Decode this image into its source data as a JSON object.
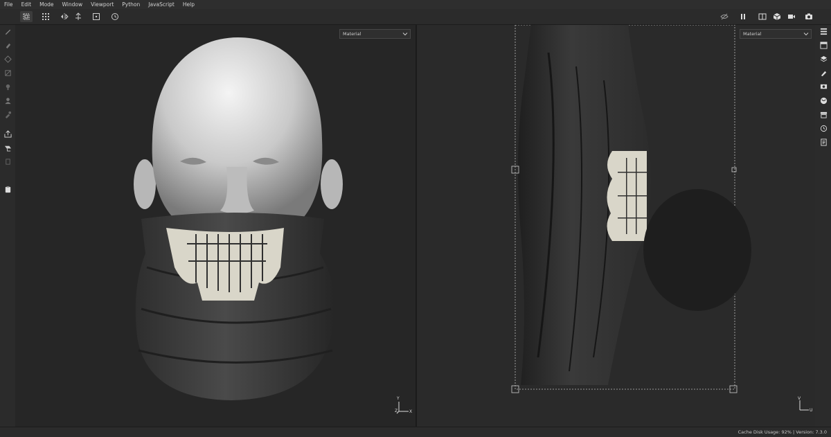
{
  "menu": [
    "File",
    "Edit",
    "Mode",
    "Window",
    "Viewport",
    "Python",
    "JavaScript",
    "Help"
  ],
  "viewport_left": {
    "shader_label": "Material",
    "axis_z": "Z",
    "axis_x": "X",
    "axis_y": "Y"
  },
  "viewport_right": {
    "shader_label": "Material",
    "axis_u": "U",
    "axis_v": "V"
  },
  "status": {
    "cache_label": "Cache Disk Usage:",
    "cache_value": "92%",
    "separator": "|",
    "version_label": "Version:",
    "version_value": "7.3.0"
  },
  "icons": {
    "toolbar_left": [
      "uv-selection-icon",
      "grid-tiles-icon",
      "symmetry-icon",
      "transform-icon",
      "frame-icon",
      "history-icon"
    ],
    "toolbar_right": [
      "hide-icon",
      "pause-icon",
      "split-view-icon",
      "cube-icon",
      "camera-video-icon",
      "screenshot-icon"
    ],
    "left_tools": [
      "paint-brush-icon",
      "eraser-icon",
      "projection-icon",
      "polyfill-icon",
      "smudge-icon",
      "clone-icon",
      "color-picker-icon",
      "export-icon",
      "bake-icon",
      "fill-icon",
      "clipboard-icon"
    ],
    "right_panels": [
      "texture-set-list-icon",
      "texture-set-settings-icon",
      "layers-icon",
      "brush-properties-icon",
      "display-settings-icon",
      "shader-settings-icon",
      "shelf-icon",
      "history-panel-icon",
      "log-icon"
    ]
  },
  "colors": {
    "background": "#252525",
    "panel": "#2b2b2b",
    "menubar": "#2e2e2e",
    "accent_highlight": "#3c3c3c",
    "viewport_left": "#262626",
    "viewport_right": "#2a2a2a"
  }
}
